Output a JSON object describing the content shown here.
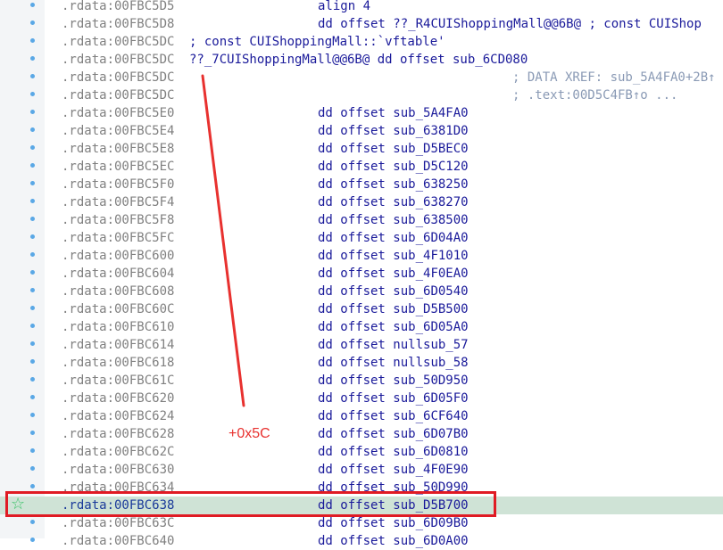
{
  "colors": {
    "address": "#808080",
    "code": "#1a1a9a",
    "comment": "#8a9ab5",
    "annotation": "#e8312f",
    "highlight_row": "#cfe3d6",
    "breakpoint_dot": "#5aa8e6"
  },
  "rows": [
    {
      "addr": ".rdata:00FBC5D5",
      "kw": "align 4",
      "sym": ""
    },
    {
      "addr": ".rdata:00FBC5D8",
      "kw": "dd offset ",
      "sym": "??_R4CUIShoppingMall@@6B@ ; const CUIShop"
    },
    {
      "addr": ".rdata:00FBC5DC",
      "full": "; const CUIShoppingMall::`vftable'"
    },
    {
      "addr": ".rdata:00FBC5DC",
      "full": "??_7CUIShoppingMall@@6B@ dd offset sub_6CD080"
    },
    {
      "addr": ".rdata:00FBC5DC",
      "cmt": "; DATA XREF: sub_5A4FA0+2B↑"
    },
    {
      "addr": ".rdata:00FBC5DC",
      "cmt": "; .text:00D5C4FB↑o ..."
    },
    {
      "addr": ".rdata:00FBC5E0",
      "kw": "dd offset ",
      "sym": "sub_5A4FA0"
    },
    {
      "addr": ".rdata:00FBC5E4",
      "kw": "dd offset ",
      "sym": "sub_6381D0"
    },
    {
      "addr": ".rdata:00FBC5E8",
      "kw": "dd offset ",
      "sym": "sub_D5BEC0"
    },
    {
      "addr": ".rdata:00FBC5EC",
      "kw": "dd offset ",
      "sym": "sub_D5C120"
    },
    {
      "addr": ".rdata:00FBC5F0",
      "kw": "dd offset ",
      "sym": "sub_638250"
    },
    {
      "addr": ".rdata:00FBC5F4",
      "kw": "dd offset ",
      "sym": "sub_638270"
    },
    {
      "addr": ".rdata:00FBC5F8",
      "kw": "dd offset ",
      "sym": "sub_638500"
    },
    {
      "addr": ".rdata:00FBC5FC",
      "kw": "dd offset ",
      "sym": "sub_6D04A0"
    },
    {
      "addr": ".rdata:00FBC600",
      "kw": "dd offset ",
      "sym": "sub_4F1010"
    },
    {
      "addr": ".rdata:00FBC604",
      "kw": "dd offset ",
      "sym": "sub_4F0EA0"
    },
    {
      "addr": ".rdata:00FBC608",
      "kw": "dd offset ",
      "sym": "sub_6D0540"
    },
    {
      "addr": ".rdata:00FBC60C",
      "kw": "dd offset ",
      "sym": "sub_D5B500"
    },
    {
      "addr": ".rdata:00FBC610",
      "kw": "dd offset ",
      "sym": "sub_6D05A0"
    },
    {
      "addr": ".rdata:00FBC614",
      "kw": "dd offset ",
      "sym": "nullsub_57"
    },
    {
      "addr": ".rdata:00FBC618",
      "kw": "dd offset ",
      "sym": "nullsub_58"
    },
    {
      "addr": ".rdata:00FBC61C",
      "kw": "dd offset ",
      "sym": "sub_50D950"
    },
    {
      "addr": ".rdata:00FBC620",
      "kw": "dd offset ",
      "sym": "sub_6D05F0"
    },
    {
      "addr": ".rdata:00FBC624",
      "kw": "dd offset ",
      "sym": "sub_6CF640"
    },
    {
      "addr": ".rdata:00FBC628",
      "kw": "dd offset ",
      "sym": "sub_6D07B0"
    },
    {
      "addr": ".rdata:00FBC62C",
      "kw": "dd offset ",
      "sym": "sub_6D0810"
    },
    {
      "addr": ".rdata:00FBC630",
      "kw": "dd offset ",
      "sym": "sub_4F0E90"
    },
    {
      "addr": ".rdata:00FBC634",
      "kw": "dd offset ",
      "sym": "sub_50D990"
    },
    {
      "addr": ".rdata:00FBC638",
      "kw": "dd offset ",
      "sym": "sub_D5B700",
      "highlight": true
    },
    {
      "addr": ".rdata:00FBC63C",
      "kw": "dd offset ",
      "sym": "sub_6D09B0"
    },
    {
      "addr": ".rdata:00FBC640",
      "kw": "dd offset ",
      "sym": "sub_6D0A00"
    }
  ],
  "annotation": {
    "offset_label": "+0x5C"
  }
}
